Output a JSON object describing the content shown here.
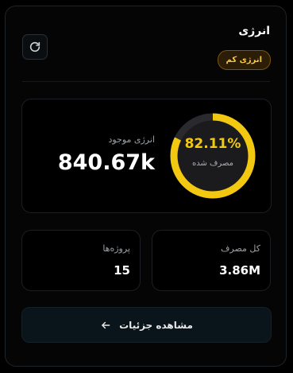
{
  "card": {
    "title": "انرژی",
    "badge": "انرژی کم"
  },
  "energy": {
    "available_label": "انرژی موجود",
    "available_value": "840.67k",
    "consumed_percent": 82.11,
    "consumed_percent_label": "82.11%",
    "consumed_label": "مصرف شده"
  },
  "stats": {
    "total_consumption_label": "کل مصرف",
    "total_consumption_value": "3.86M",
    "projects_label": "پروژه‌ها",
    "projects_value": "15"
  },
  "actions": {
    "details_label": "مشاهده جزئیات"
  },
  "colors": {
    "accent": "#f2c811",
    "badge_text": "#f7c744",
    "badge_bg": "#2b1d06"
  }
}
